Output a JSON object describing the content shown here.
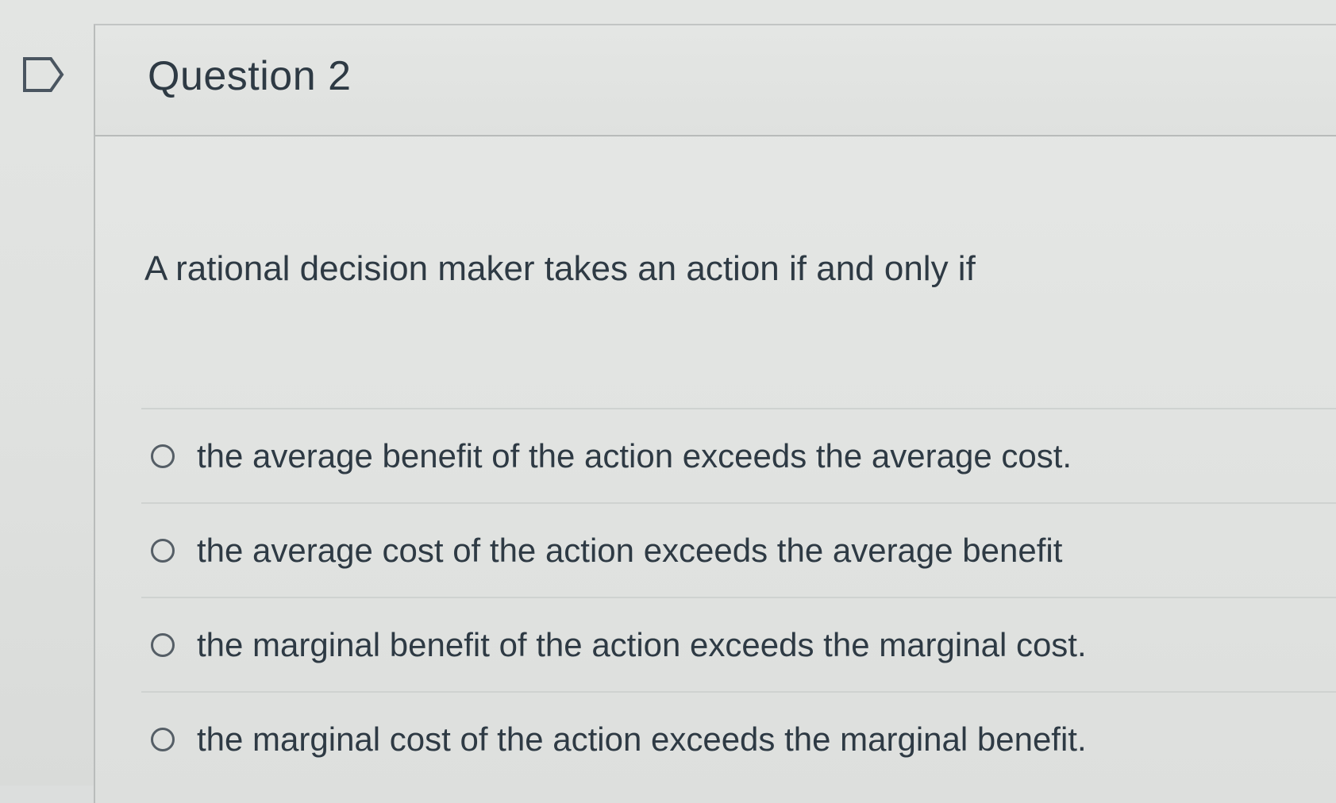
{
  "question": {
    "title": "Question 2",
    "prompt": "A rational decision maker takes an action if and only if",
    "answers": [
      {
        "label": "the average benefit of the action exceeds the average cost.",
        "selected": false
      },
      {
        "label": "the average cost of the action exceeds the average benefit",
        "selected": false
      },
      {
        "label": "the marginal benefit of the action exceeds the marginal cost.",
        "selected": false
      },
      {
        "label": "the marginal cost of the action exceeds the marginal benefit.",
        "selected": false
      }
    ]
  },
  "icons": {
    "flag": "flag-question-icon"
  },
  "colors": {
    "text": "#2e3a44",
    "border": "#b8bbba",
    "background": "#e2e4e2"
  }
}
